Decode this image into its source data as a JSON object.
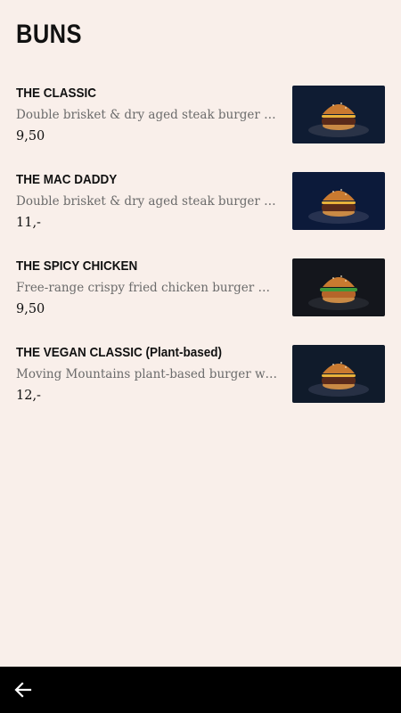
{
  "header": {
    "title": "BUNS"
  },
  "items": [
    {
      "name": "THE CLASSIC",
      "description": "Double brisket & dry aged steak burger with …",
      "price": "9,50",
      "image_icon": "classic-burger-photo",
      "bg": "#0f1c33",
      "plate": "#2a3347"
    },
    {
      "name": "THE MAC DADDY",
      "description": "Double brisket & dry aged steak burger toppe…",
      "price": "11,-",
      "image_icon": "mac-daddy-burger-photo",
      "bg": "#0c1a3a",
      "plate": "#273250"
    },
    {
      "name": "THE SPICY CHICKEN",
      "description": "Free-range crispy fried chicken burger with b…",
      "price": "9,50",
      "image_icon": "spicy-chicken-burger-photo",
      "bg": "#14161c",
      "plate": "#24272e"
    },
    {
      "name": "THE VEGAN CLASSIC (Plant-based)",
      "description": "Moving Mountains plant-based burger with v…",
      "price": "12,-",
      "image_icon": "vegan-burger-photo",
      "bg": "#101b2b",
      "plate": "#273044"
    }
  ],
  "navbar": {
    "back_icon": "back-arrow-icon"
  }
}
